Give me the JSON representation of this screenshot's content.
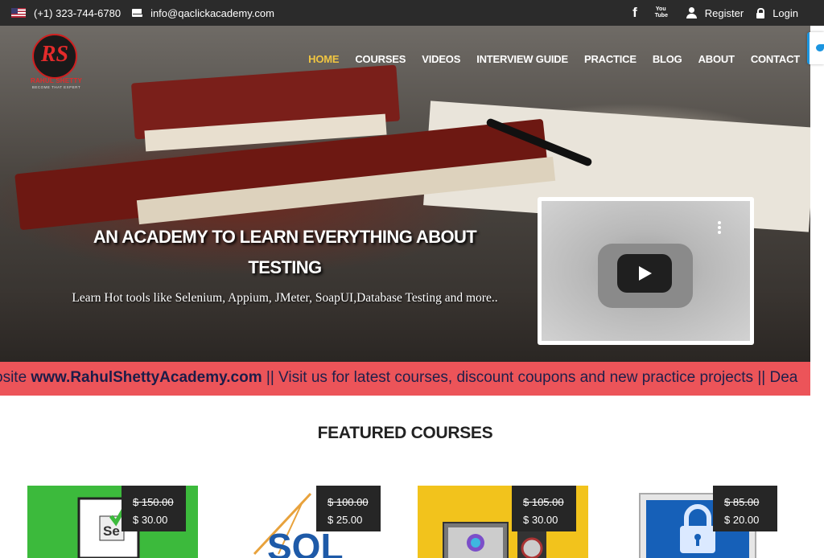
{
  "topbar": {
    "phone": "(+1) 323-744-6780",
    "email": "info@qaclickacademy.com",
    "register": "Register",
    "login": "Login",
    "social_icons": [
      "facebook-icon",
      "youtube-icon"
    ]
  },
  "logo": {
    "mark": "RS",
    "name": "RAHUL SHETTY",
    "tagline": "BECOME THAT EXPERT"
  },
  "nav": {
    "items": [
      "HOME",
      "COURSES",
      "VIDEOS",
      "INTERVIEW GUIDE",
      "PRACTICE",
      "BLOG",
      "ABOUT",
      "CONTACT"
    ],
    "active": "HOME",
    "active_color": "#f0c541"
  },
  "hero": {
    "title": "AN ACADEMY TO LEARN EVERYTHING ABOUT TESTING",
    "subtitle": "Learn Hot tools like Selenium, Appium, JMeter, SoapUI,Database Testing and more.."
  },
  "marquee": {
    "prefix": "osite ",
    "link": "www.RahulShettyAcademy.com",
    "rest": " || Visit us for latest courses, discount coupons and new practice projects || Dea",
    "background": "#ec5459"
  },
  "featured": {
    "title": "FEATURED COURSES",
    "courses": [
      {
        "old_price": "$ 150.00",
        "price": "$ 30.00"
      },
      {
        "old_price": "$ 100.00",
        "price": "$ 25.00"
      },
      {
        "old_price": "$ 105.00",
        "price": "$ 30.00"
      },
      {
        "old_price": "$ 85.00",
        "price": "$ 20.00"
      }
    ]
  }
}
